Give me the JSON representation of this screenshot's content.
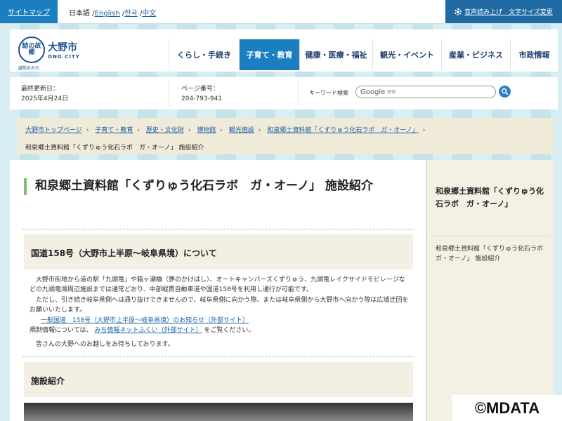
{
  "topbar": {
    "sitemap": "サイトマップ",
    "lang_current": "日本語",
    "lang_sep": "/",
    "lang_links": [
      "English",
      "한국",
      "中文"
    ],
    "voice_label": "音声読み上げ　文字サイズ変更"
  },
  "header": {
    "logo_mark": "結の故郷",
    "logo_name": "大野市",
    "logo_en": "ONO CITY",
    "logo_sub": "越前おおの",
    "nav": [
      "くらし・手続き",
      "子育て・教育",
      "健康・医療・福祉",
      "観光・イベント",
      "産業・ビジネス",
      "市政情報"
    ],
    "nav_active_index": 1
  },
  "info": {
    "updated_label": "最終更新日：",
    "updated_value": "2025年4月24日",
    "pageno_label": "ページ番号：",
    "pageno_value": "204-793-941",
    "search_label": "キーワード検索",
    "search_google": "Google",
    "search_placeholder": "提供"
  },
  "breadcrumb": {
    "items": [
      "大野市トップページ",
      "子育て・教育",
      "歴史・文化財",
      "博物館",
      "観光施設",
      "和泉郷土資料館「くずりゅう化石ラボ　ガ・オーノ」"
    ],
    "current": "和泉郷土資料館「くずりゅう化石ラボ　ガ・オーノ」 施設紹介"
  },
  "main": {
    "title": "和泉郷土資料館「くずりゅう化石ラボ　ガ・オーノ」 施設紹介",
    "section1_title": "国道158号（大野市上半原～岐阜県境）について",
    "para1": "大野市街地から道の駅「九頭竜」や箱ヶ瀬橋（夢のかけはし）、オートキャンパーズくずりゅう、九頭竜レイクサイドモビレージなどの九頭竜湖周辺施設までは通常どおり、中部縦貫自動車道や国道158号を利用し通行が可能です。",
    "para2": "ただし、引き続き岐阜県側へは通り抜けできませんので、岐阜県側に向かう際、または岐阜県側から大野市へ向かう際は広域迂回をお願いいたします。",
    "link1": "一般国道　158号（大野市上半原～岐阜県境）のお知らせ（外部サイト）",
    "line3_pre": "規制情報については、",
    "link2": "みち情報ネットふくい（外部サイト）",
    "line3_post": "をご覧ください。",
    "para4": "皆さんの大野へのお越しをお待ちしております。",
    "section2_title": "施設紹介"
  },
  "side": {
    "title": "和泉郷土資料館「くずりゅう化石ラボ　ガ・オーノ」",
    "link": "和泉郷土資料館「くずりゅう化石ラボ　ガ・オーノ」 施設紹介"
  },
  "watermark": "©MDATA",
  "colors": {
    "accent_blue": "#1b7fbf",
    "title_bar_green": "#7fbf6f",
    "beige": "#f0ead8"
  }
}
